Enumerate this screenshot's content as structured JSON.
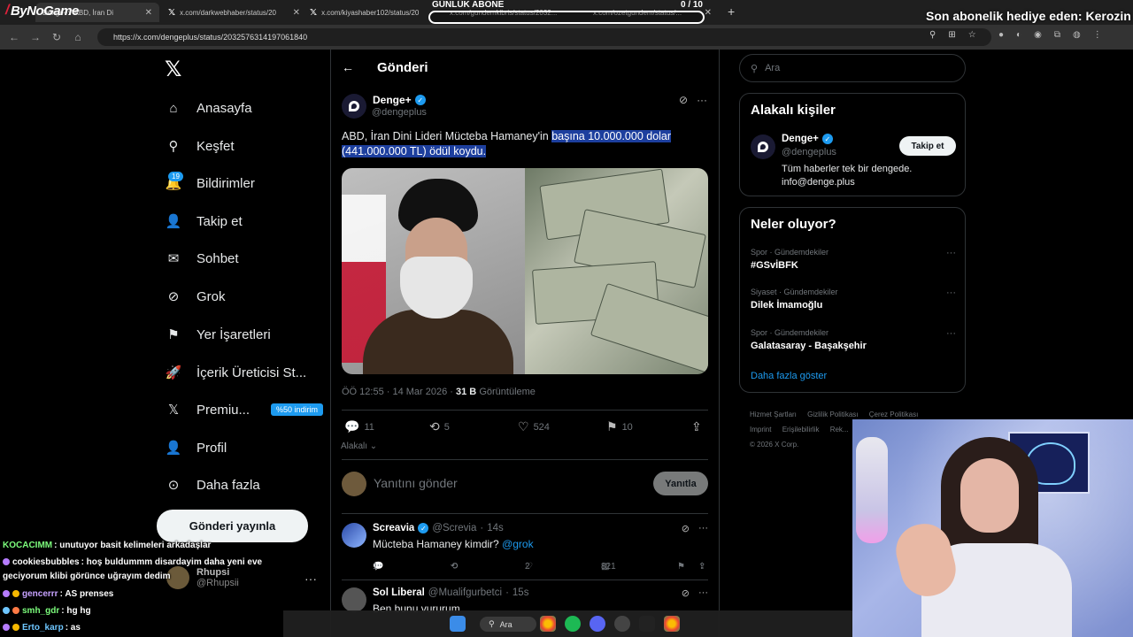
{
  "browser": {
    "tabs": [
      {
        "label": "Denge+: \"ABD, İran Di"
      },
      {
        "label": "x.com/darkwebhaber/status/20"
      },
      {
        "label": "x.com/kiyashaber102/status/20"
      },
      {
        "label": "x.com/gundemkibris/status/2032..."
      },
      {
        "label": "x.com/ozetgundem/status/..."
      }
    ],
    "url": "https://x.com/dengeplus/status/2032576314197061840"
  },
  "overlay": {
    "stream_brand": "ByNoGame",
    "goal_title": "GÜNLÜK ABONE",
    "goal_count": "0",
    "goal_target": "/ 10",
    "sub_gift": "Son abonelik hediye eden: Kerozin"
  },
  "nav": {
    "items": [
      {
        "label": "Anasayfa",
        "icon": "home-icon"
      },
      {
        "label": "Keşfet",
        "icon": "search-icon"
      },
      {
        "label": "Bildirimler",
        "icon": "bell-icon"
      },
      {
        "label": "Takip et",
        "icon": "follow-icon"
      },
      {
        "label": "Sohbet",
        "icon": "mail-icon"
      },
      {
        "label": "Grok",
        "icon": "grok-icon"
      },
      {
        "label": "Yer İşaretleri",
        "icon": "bookmark-icon"
      },
      {
        "label": "İçerik Üreticisi St...",
        "icon": "rocket-icon"
      },
      {
        "label": "Premiu...",
        "icon": "x-premium-icon"
      },
      {
        "label": "Profil",
        "icon": "person-icon"
      },
      {
        "label": "Daha fazla",
        "icon": "more-circle-icon"
      }
    ],
    "notif_count": "19",
    "premium_tag": "%50 indirim",
    "post_button": "Gönderi yayınla",
    "account_name": "Rhupsi",
    "account_handle": "@Rhupsii"
  },
  "main": {
    "title": "Gönderi",
    "post": {
      "name": "Denge+",
      "handle": "@dengeplus",
      "text_plain": "ABD, İran Dini Lideri Mücteba Hamaney'in ",
      "text_highlight": "başına 10.000.000 dolar (441.000.000 TL) ödül koydu.",
      "time": "ÖÖ 12:55 · 14 Mar 2026 · ",
      "views": "31 B",
      "views_label": " Görüntüleme",
      "replies": "11",
      "reposts": "5",
      "likes": "524",
      "bookmarks": "10",
      "sort_label": "Alakalı"
    },
    "reply_box": {
      "placeholder": "Yanıtını gönder",
      "button": "Yanıtla"
    },
    "replies": [
      {
        "name": "Screavia",
        "handle": "@Screvia",
        "time": "14s",
        "text": "Mücteba Hamaney kimdir?",
        "mention": "@grok",
        "replies": "1",
        "likes": "2",
        "views": "821"
      },
      {
        "name": "Sol Liberal",
        "handle": "@Mualifgurbetci",
        "time": "15s",
        "text": "Ben bunu vururum"
      }
    ]
  },
  "sidebar": {
    "search_placeholder": "Ara",
    "related_title": "Alakalı kişiler",
    "related": {
      "name": "Denge+",
      "handle": "@dengeplus",
      "bio": "Tüm haberler tek bir dengede. info@denge.plus",
      "follow": "Takip et"
    },
    "trends_title": "Neler oluyor?",
    "trends": [
      {
        "meta": "Spor · Gündemdekiler",
        "name": "#GSvİBFK"
      },
      {
        "meta": "Siyaset · Gündemdekiler",
        "name": "Dilek İmamoğlu"
      },
      {
        "meta": "Spor · Gündemdekiler",
        "name": "Galatasaray - Başakşehir"
      }
    ],
    "show_more": "Daha fazla göster",
    "footer": [
      "Hizmet Şartları",
      "Gizlilik Politikası",
      "Çerez Politikası",
      "Imprint",
      "Erişilebilirlik",
      "Rek...",
      "© 2026 X Corp."
    ]
  },
  "chat": [
    {
      "user": "KOCACIMM",
      "msg": ": unutuyor basit kelimeleri arkadaşlar",
      "color": "#7cfc7c"
    },
    {
      "user": "cookiesbubbles",
      "msg": ": hoş buldummm disardayim daha yeni eve",
      "color": "#ffffff"
    },
    {
      "user": "",
      "msg": "geciyorum klibi görünce uğrayım dedim",
      "color": "#ffffff"
    },
    {
      "user": "gencerrr",
      "msg": ": AS prenses",
      "color": "#c7a2ff"
    },
    {
      "user": "smh_gdr",
      "msg": ": hg hg",
      "color": "#7cfc7c"
    },
    {
      "user": "Erto_karp",
      "msg": ": as",
      "color": "#6ec6ff"
    }
  ],
  "taskbar": {
    "search_label": "Ara"
  }
}
